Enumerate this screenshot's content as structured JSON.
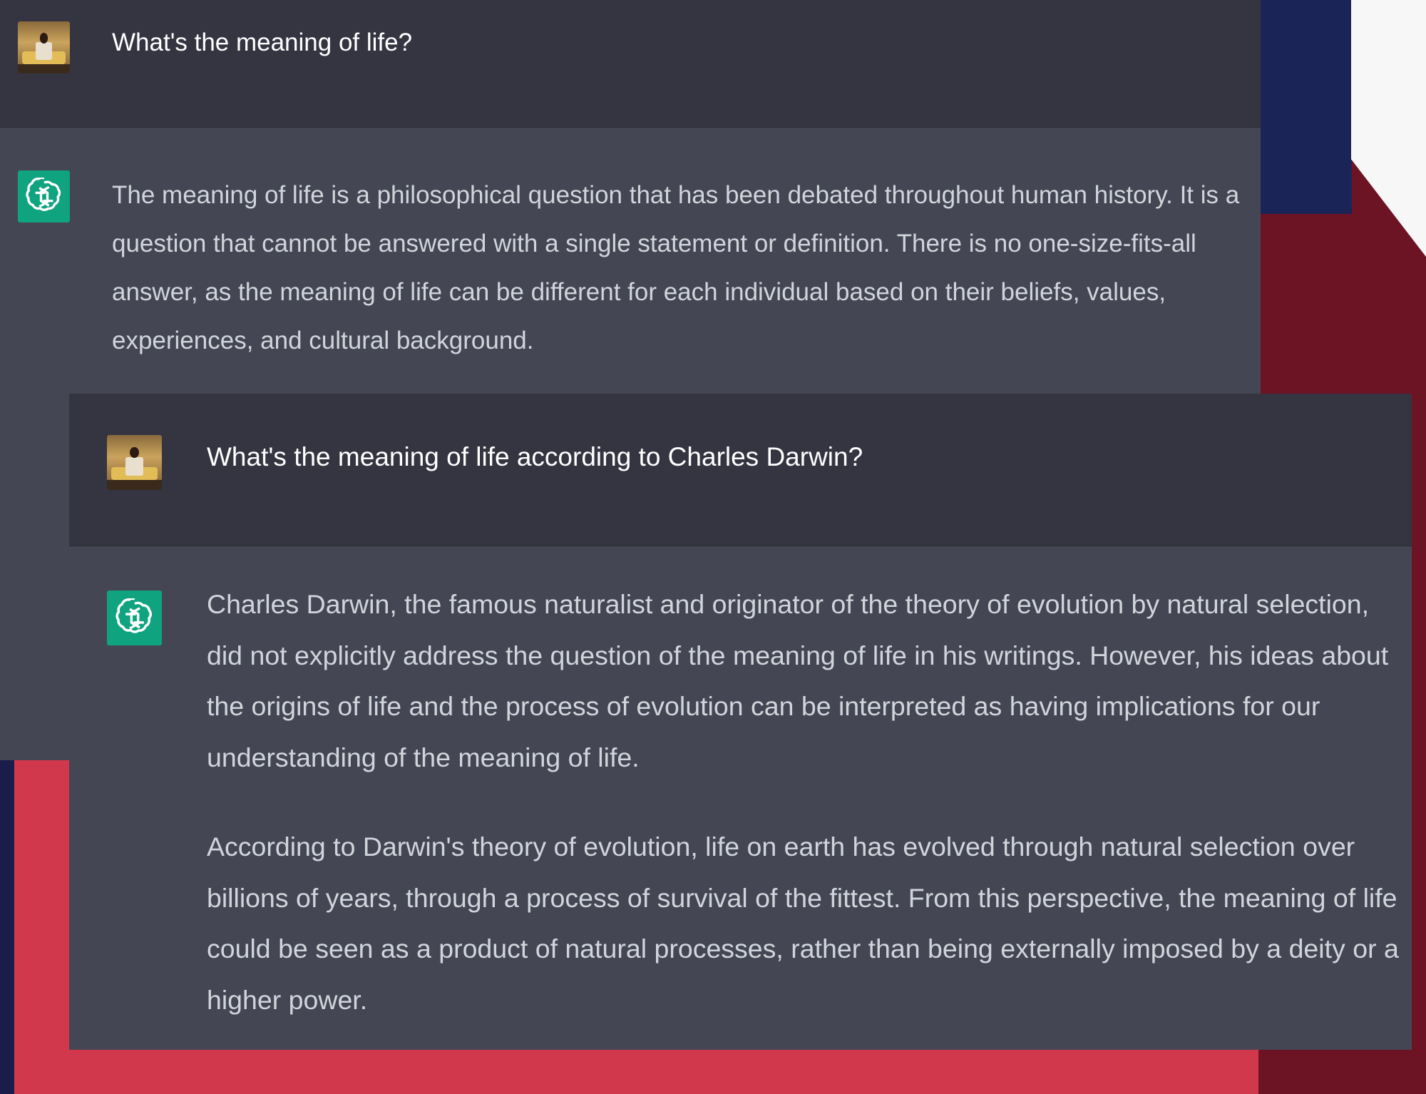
{
  "conversation_1": {
    "user_message": "What's the meaning of life?",
    "assistant_message": "The meaning of life is a philosophical question that has been debated throughout human history. It is a question that cannot be answered with a single statement or definition. There is no one-size-fits-all answer, as the meaning of life can be different for each individual based on their beliefs, values, experiences, and cultural background."
  },
  "conversation_2": {
    "user_message": "What's the meaning of life according to Charles Darwin?",
    "assistant_paragraphs": [
      "Charles Darwin, the famous naturalist and originator of the theory of evolution by natural selection, did not explicitly address the question of the meaning of life in his writings. However, his ideas about the origins of life and the process of evolution can be interpreted as having implications for our understanding of the meaning of life.",
      "According to Darwin's theory of evolution, life on earth has evolved through natural selection over billions of years, through a process of survival of the fittest. From this perspective, the meaning of life could be seen as a product of natural processes, rather than being externally imposed by a deity or a higher power."
    ]
  },
  "icons": {
    "user_avatar": "user-avatar-photo",
    "assistant_avatar": "openai-logo-icon"
  },
  "colors": {
    "user_row_bg": "#343541",
    "assistant_row_bg": "#444654",
    "assistant_logo_bg": "#10a37f",
    "background_red": "#d1384c",
    "background_crimson": "#6d1424",
    "background_navy": "#1a1d4a"
  }
}
